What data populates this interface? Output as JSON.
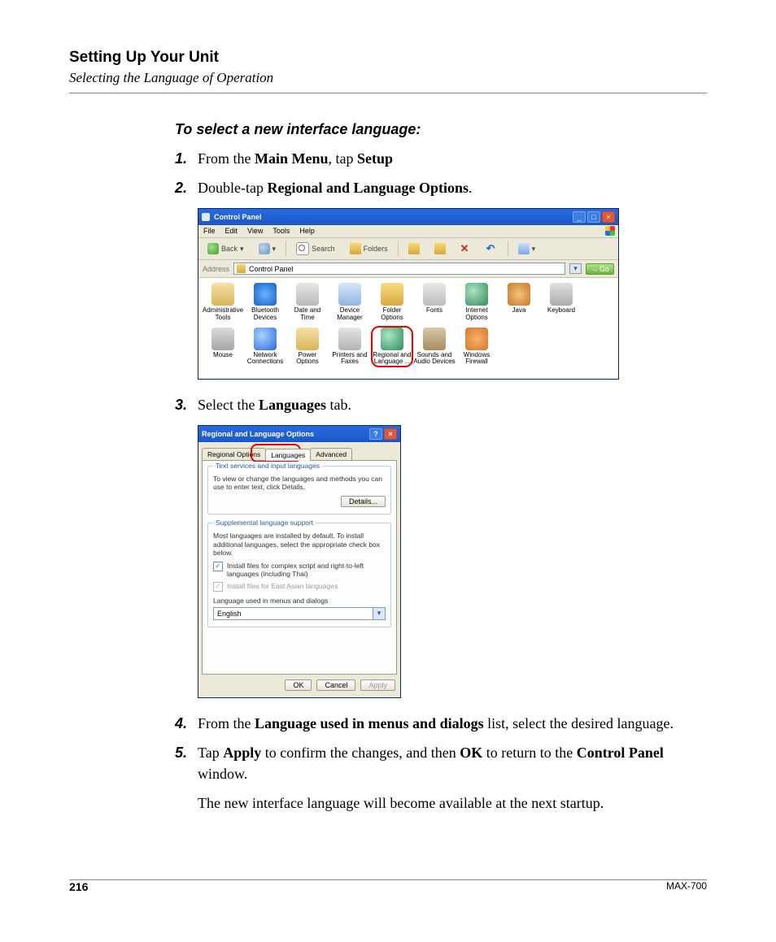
{
  "header": {
    "title": "Setting Up Your Unit",
    "subtitle": "Selecting the Language of Operation"
  },
  "intro": "To select a new interface language:",
  "steps": {
    "s1_pre": "From the ",
    "s1_b1": "Main Menu",
    "s1_mid": ", tap ",
    "s1_b2": "Setup",
    "s2_pre": "Double-tap ",
    "s2_b1": "Regional and Language Options",
    "s2_post": ".",
    "s3_pre": "Select the ",
    "s3_b1": "Languages",
    "s3_post": " tab.",
    "s4_pre": "From the ",
    "s4_b1": "Language used in menus and dialogs",
    "s4_post": " list, select the desired language.",
    "s5_pre": "Tap ",
    "s5_b1": "Apply",
    "s5_mid": " to confirm the changes, and then ",
    "s5_b2": "OK",
    "s5_mid2": " to return to the ",
    "s5_b3": "Control Panel",
    "s5_post": " window."
  },
  "closing": "The new interface language will become available at the next startup.",
  "cp": {
    "title": "Control Panel",
    "menus": [
      "File",
      "Edit",
      "View",
      "Tools",
      "Help"
    ],
    "back": "Back",
    "search": "Search",
    "folders": "Folders",
    "addr_label": "Address",
    "addr_value": "Control Panel",
    "go": "Go",
    "icons": [
      "Administrative Tools",
      "Bluetooth Devices",
      "Date and Time",
      "Device Manager",
      "Folder Options",
      "Fonts",
      "Internet Options",
      "Java",
      "Keyboard",
      "Mouse",
      "Network Connections",
      "Power Options",
      "Printers and Faxes",
      "Regional and Language ...",
      "Sounds and Audio Devices",
      "Windows Firewall"
    ]
  },
  "rl": {
    "title": "Regional and Language Options",
    "tabs": [
      "Regional Options",
      "Languages",
      "Advanced"
    ],
    "grp1_cap": "Text services and input languages",
    "grp1_txt": "To view or change the languages and methods you can use to enter text, click Details.",
    "details": "Details...",
    "grp2_cap": "Supplemental language support",
    "grp2_txt": "Most languages are installed by default. To install additional languages, select the appropriate check box below.",
    "chk1": "Install files for complex script and right-to-left languages (including Thai)",
    "chk2": "Install files for East Asian languages",
    "lang_label": "Language used in menus and dialogs",
    "lang_value": "English",
    "ok": "OK",
    "cancel": "Cancel",
    "apply": "Apply"
  },
  "footer": {
    "page": "216",
    "model": "MAX-700"
  }
}
